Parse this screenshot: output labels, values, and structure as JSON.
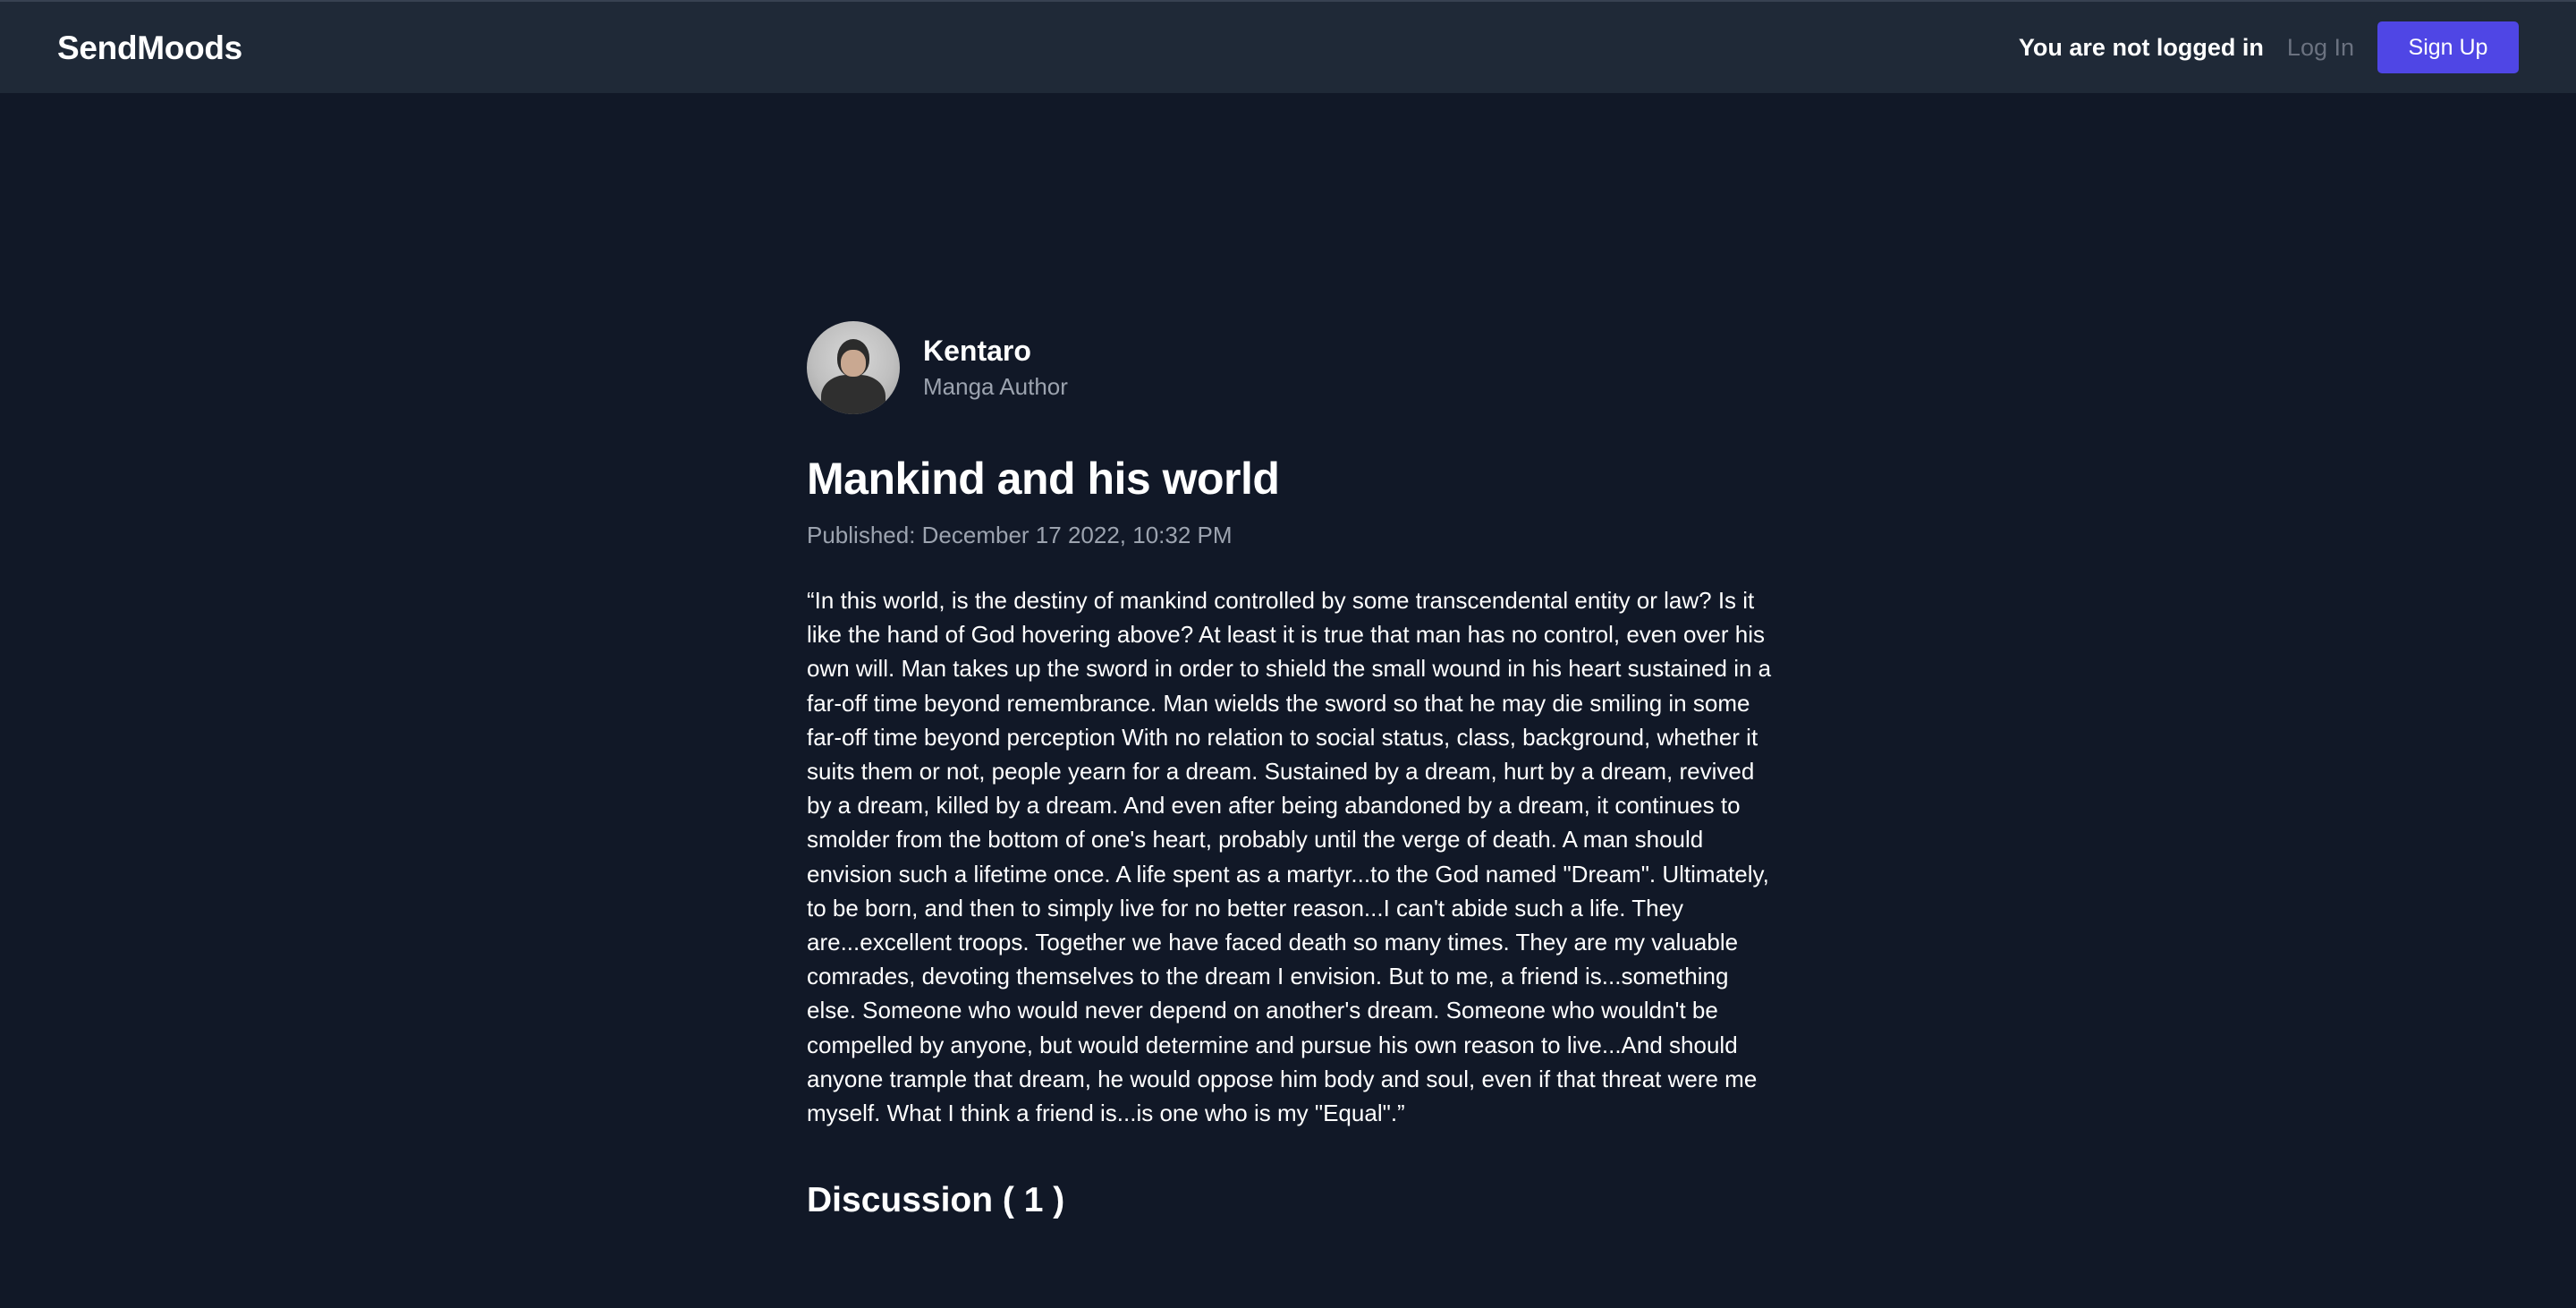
{
  "header": {
    "brand": "SendMoods",
    "login_status": "You are not logged in",
    "login_label": "Log In",
    "signup_label": "Sign Up"
  },
  "author": {
    "name": "Kentaro",
    "role": "Manga Author"
  },
  "post": {
    "title": "Mankind and his world",
    "published": "Published: December 17 2022, 10:32 PM",
    "body": "“In this world, is the destiny of mankind controlled by some transcendental entity or law? Is it like the hand of God hovering above? At least it is true that man has no control, even over his own will. Man takes up the sword in order to shield the small wound in his heart sustained in a far-off time beyond remembrance. Man wields the sword so that he may die smiling in some far-off time beyond perception With no relation to social status, class, background, whether it suits them or not, people yearn for a dream. Sustained by a dream, hurt by a dream, revived by a dream, killed by a dream. And even after being abandoned by a dream, it continues to smolder from the bottom of one's heart, probably until the verge of death. A man should envision such a lifetime once. A life spent as a martyr...to the God named \"Dream\". Ultimately, to be born, and then to simply live for no better reason...I can't abide such a life. They are...excellent troops. Together we have faced death so many times. They are my valuable comrades, devoting themselves to the dream I envision. But to me, a friend is...something else. Someone who would never depend on another's dream. Someone who wouldn't be compelled by anyone, but would determine and pursue his own reason to live...And should anyone trample that dream, he would oppose him body and soul, even if that threat were me myself. What I think a friend is...is one who is my \"Equal\".”"
  },
  "discussion": {
    "heading": "Discussion ( 1 )"
  },
  "colors": {
    "background": "#111827",
    "topbar": "#1f2937",
    "accent": "#4f46e5",
    "muted": "#9ca3af"
  }
}
